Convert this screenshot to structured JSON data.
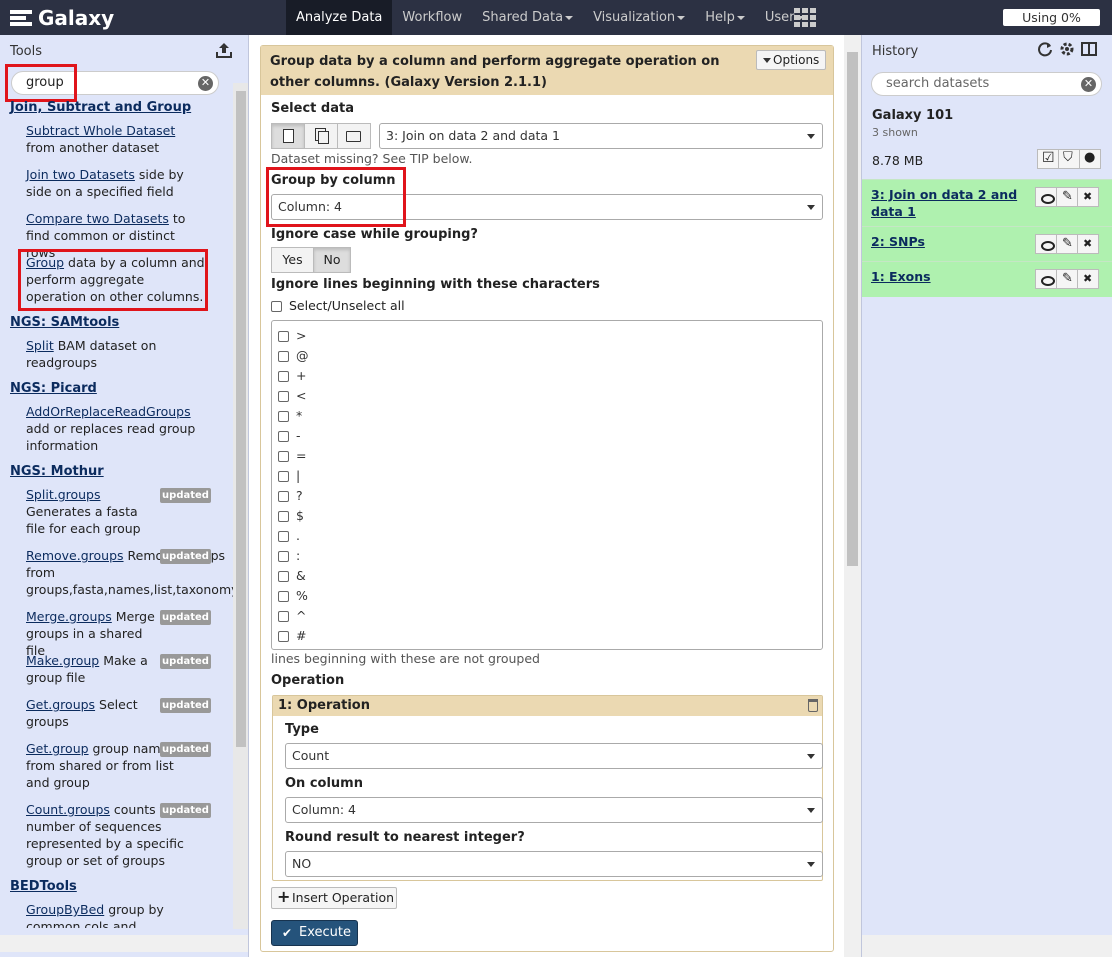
{
  "masthead": {
    "brand": "Galaxy",
    "nav": [
      {
        "label": "Analyze Data"
      },
      {
        "label": "Workflow"
      },
      {
        "label": "Shared Data"
      },
      {
        "label": "Visualization"
      },
      {
        "label": "Help"
      },
      {
        "label": "User"
      }
    ],
    "quota": "Using 0%"
  },
  "tools_panel": {
    "title": "Tools",
    "search_value": "group",
    "sections": [
      {
        "title": "Join, Subtract and Group"
      },
      {
        "title": "NGS: SAMtools"
      },
      {
        "title": "NGS: Picard"
      },
      {
        "title": "NGS: Mothur"
      },
      {
        "title": "BEDTools"
      }
    ],
    "tools": [
      {
        "name": "Subtract Whole Dataset",
        "desc": " from another dataset"
      },
      {
        "name": "Join two Datasets",
        "desc": " side by side on a specified field"
      },
      {
        "name": "Compare two Datasets",
        "desc": " to find common or distinct rows"
      },
      {
        "name": "Group",
        "desc": " data by a column and perform aggregate operation on other columns."
      },
      {
        "name": "Split",
        "desc": " BAM dataset on readgroups"
      },
      {
        "name": "AddOrReplaceReadGroups",
        "desc": " add or replaces read group information"
      },
      {
        "name": "Split.groups",
        "desc": " Generates a fasta file for each group",
        "badge": "updated"
      },
      {
        "name": "Remove.groups",
        "desc": " Remove groups from groups,fasta,names,list,taxonomy",
        "badge": "updated"
      },
      {
        "name": "Merge.groups",
        "desc": " Merge groups in a shared file",
        "badge": "updated"
      },
      {
        "name": "Make.group",
        "desc": " Make a group file",
        "badge": "updated"
      },
      {
        "name": "Get.groups",
        "desc": " Select groups",
        "badge": "updated"
      },
      {
        "name": "Get.group",
        "desc": " group names from shared or from list and group",
        "badge": "updated"
      },
      {
        "name": "Count.groups",
        "desc": " counts the number of sequences represented by a specific group or set of groups",
        "badge": "updated"
      },
      {
        "name": "GroupByBed",
        "desc": " group by common cols and summarize"
      }
    ]
  },
  "form": {
    "title": "Group data by a column and perform aggregate operation on other columns. (Galaxy Version 2.1.1)",
    "options_label": "Options",
    "select_data_label": "Select data",
    "select_data_value": "3: Join on data 2 and data 1",
    "dataset_missing": "Dataset missing? See TIP below.",
    "group_by_label": "Group by column",
    "group_by_value": "Column: 4",
    "ignore_case_label": "Ignore case while grouping?",
    "yes_label": "Yes",
    "no_label": "No",
    "ignore_lines_label": "Ignore lines beginning with these characters",
    "select_all_label": "Select/Unselect all",
    "chars": [
      ">",
      "@",
      "+",
      "<",
      "*",
      "-",
      "=",
      "|",
      "?",
      "$",
      ".",
      ":",
      "&",
      "%",
      "^",
      "#"
    ],
    "lines_help": "lines beginning with these are not grouped",
    "operation_label": "Operation",
    "operation_title": "1: Operation",
    "type_label": "Type",
    "type_value": "Count",
    "on_column_label": "On column",
    "on_column_value": "Column: 4",
    "round_label": "Round result to nearest integer?",
    "round_value": "NO",
    "insert_label": "Insert Operation",
    "execute_label": "Execute"
  },
  "history": {
    "title": "History",
    "search_placeholder": "search datasets",
    "name": "Galaxy 101",
    "shown": "3 shown",
    "size": "8.78 MB",
    "datasets": [
      {
        "title": "3: Join on data 2 and data 1"
      },
      {
        "title": "2: SNPs"
      },
      {
        "title": "1: Exons"
      }
    ]
  },
  "colors": {
    "masthead": "#2c3143",
    "panel": "#dfe5f9",
    "form_header": "#ebd9b2",
    "dataset_ok": "#aff1af",
    "execute": "#25537b",
    "highlight": "#e0141b"
  }
}
